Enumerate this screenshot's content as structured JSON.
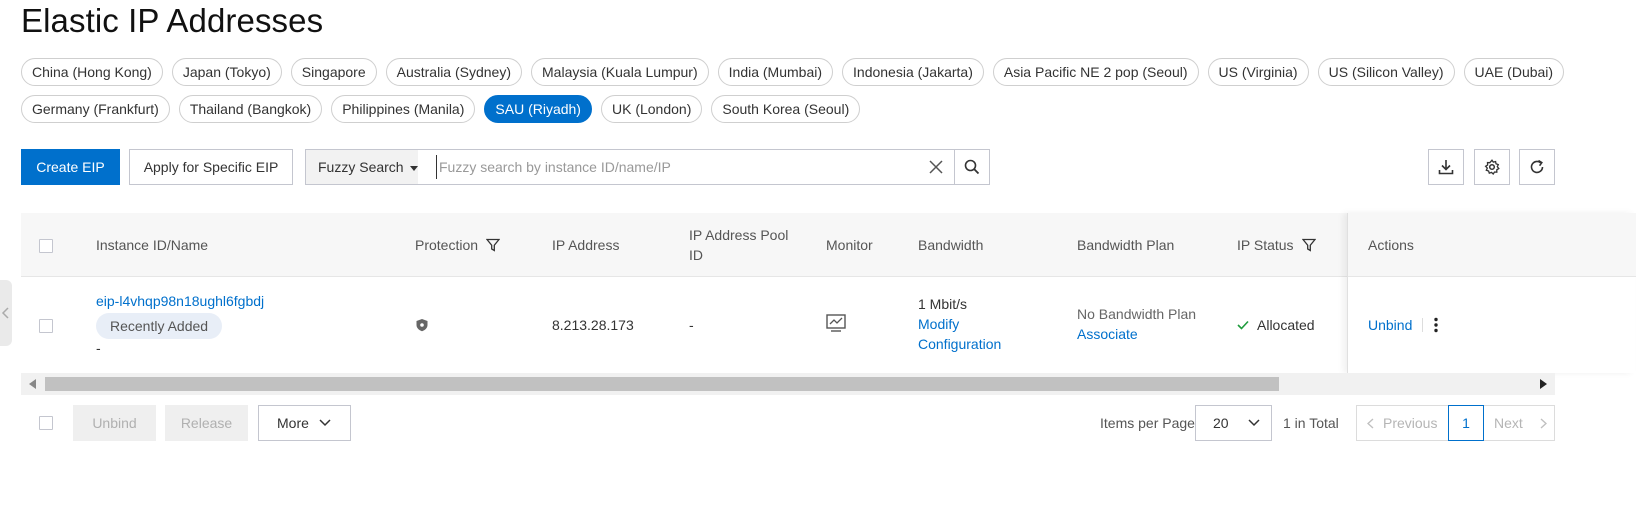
{
  "page": {
    "title": "Elastic IP Addresses"
  },
  "regions": {
    "row1": [
      "China (Hong Kong)",
      "Japan (Tokyo)",
      "Singapore",
      "Australia (Sydney)",
      "Malaysia (Kuala Lumpur)",
      "India (Mumbai)",
      "Indonesia (Jakarta)",
      "Asia Pacific NE 2 pop (Seoul)",
      "US (Virginia)",
      "US (Silicon Valley)",
      "UAE (Dubai)"
    ],
    "row2": [
      "Germany (Frankfurt)",
      "Thailand (Bangkok)",
      "Philippines (Manila)",
      "SAU (Riyadh)",
      "UK (London)",
      "South Korea (Seoul)"
    ],
    "selected": "SAU (Riyadh)"
  },
  "toolbar": {
    "create_label": "Create EIP",
    "apply_label": "Apply for Specific EIP",
    "search_mode": "Fuzzy Search",
    "search_placeholder": "Fuzzy search by instance ID/name/IP",
    "search_value": ""
  },
  "table": {
    "columns": [
      "Instance ID/Name",
      "Protection",
      "IP Address",
      "IP Address Pool ID",
      "Monitor",
      "Bandwidth",
      "Bandwidth Plan",
      "IP Status",
      "Actions"
    ],
    "rows": [
      {
        "instance_id": "eip-l4vhqp98n18ughl6fgbdj",
        "badge": "Recently Added",
        "name": "-",
        "ip_address": "8.213.28.173",
        "pool_id": "-",
        "bandwidth": "1 Mbit/s",
        "modify_link": "Modify Configuration",
        "bandwidth_plan": "No Bandwidth Plan",
        "associate_link": "Associate",
        "status": "Allocated",
        "action_unbind": "Unbind"
      }
    ]
  },
  "footer": {
    "unbind_label": "Unbind",
    "release_label": "Release",
    "more_label": "More",
    "items_per_page_label": "Items per Page",
    "page_size": "20",
    "total": "1 in Total",
    "prev_label": "Previous",
    "current_page": "1",
    "next_label": "Next"
  },
  "colors": {
    "primary": "#0070cc",
    "success": "#1e9b3c"
  }
}
